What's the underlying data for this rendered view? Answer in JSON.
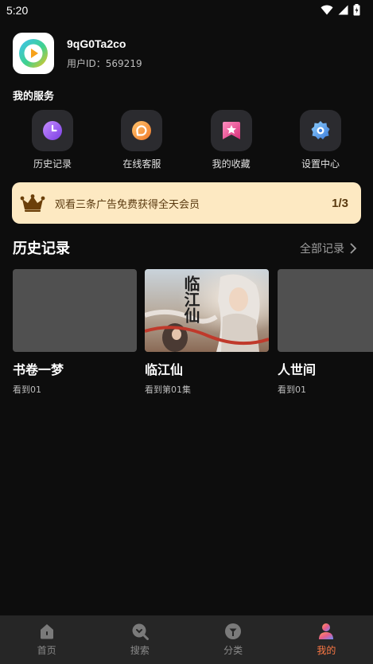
{
  "status_bar": {
    "time": "5:20"
  },
  "profile": {
    "username": "9qG0Ta2co",
    "user_id": "用户ID：569219"
  },
  "services": {
    "title": "我的服务",
    "items": [
      {
        "label": "历史记录",
        "icon": "clock-icon"
      },
      {
        "label": "在线客服",
        "icon": "chat-icon"
      },
      {
        "label": "我的收藏",
        "icon": "star-bookmark-icon"
      },
      {
        "label": "设置中心",
        "icon": "gear-icon"
      }
    ]
  },
  "ad_banner": {
    "text": "观看三条广告免费获得全天会员",
    "progress": "1/3"
  },
  "history": {
    "title": "历史记录",
    "view_all": "全部记录",
    "items": [
      {
        "title": "书卷一梦",
        "progress": "看到01"
      },
      {
        "title": "临江仙",
        "progress": "看到第01集",
        "poster_text": "临江仙"
      },
      {
        "title": "人世间",
        "progress": "看到01"
      }
    ]
  },
  "bottom_nav": {
    "items": [
      {
        "label": "首页",
        "icon": "home-icon"
      },
      {
        "label": "搜索",
        "icon": "search-icon"
      },
      {
        "label": "分类",
        "icon": "category-icon"
      },
      {
        "label": "我的",
        "icon": "profile-icon",
        "active": true
      }
    ]
  },
  "colors": {
    "accent": "#ff7a45",
    "banner_bg": "#fde9c2",
    "banner_text": "#5a3a10",
    "background": "#0d0d0d"
  }
}
